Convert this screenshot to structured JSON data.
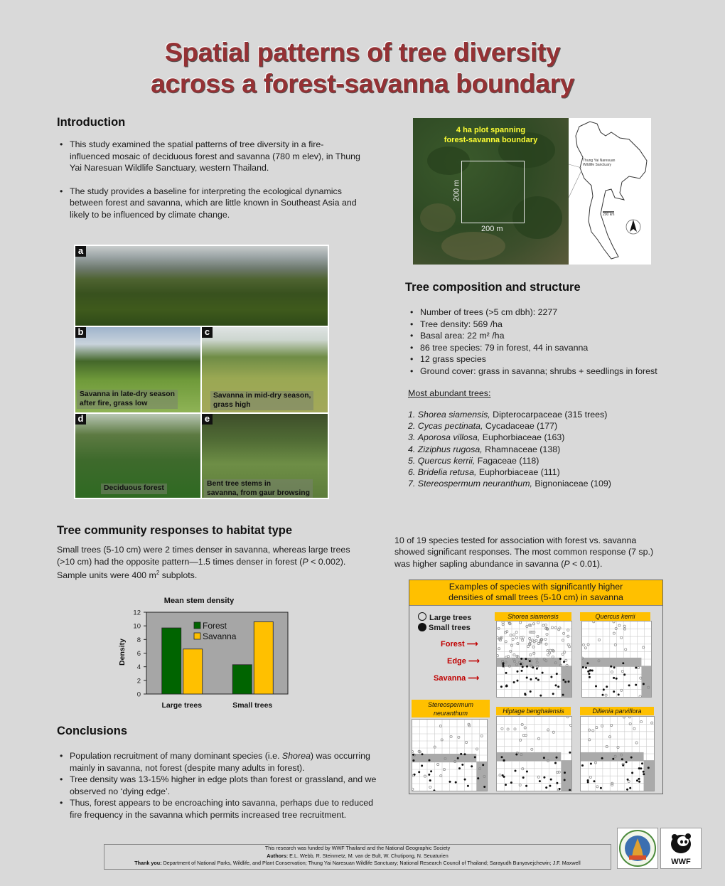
{
  "title": {
    "line1": "Spatial patterns of tree diversity",
    "line2": "across a forest-savanna boundary"
  },
  "introduction": {
    "heading": "Introduction",
    "bullets": [
      "This study examined the spatial patterns of tree diversity in a fire-influenced mosaic of deciduous forest and savanna (780 m elev), in Thung Yai Naresuan Wildlife Sanctuary, western Thailand.",
      "The study provides a baseline for interpreting the ecological dynamics between forest and savanna, which are little known in Southeast Asia and likely to be influenced by climate change."
    ]
  },
  "satellite": {
    "caption_line1": "4 ha plot spanning",
    "caption_line2": "forest-savanna boundary",
    "side_label": "200 m",
    "bottom_label": "200 m"
  },
  "map": {
    "location_label_line1": "Thung Yai Naresuan",
    "location_label_line2": "Wildlife Sanctuary",
    "scale_label": "200 km",
    "north_arrow_icon": "north-arrow-icon"
  },
  "photos": [
    {
      "letter": "a",
      "caption": ""
    },
    {
      "letter": "b",
      "caption_line1": "Savanna in late-dry season",
      "caption_line2": "after fire, grass low"
    },
    {
      "letter": "c",
      "caption_line1": "Savanna in mid-dry season,",
      "caption_line2": "grass high"
    },
    {
      "letter": "d",
      "caption_line1": "Deciduous forest",
      "caption_line2": ""
    },
    {
      "letter": "e",
      "caption_line1": "Bent tree stems in",
      "caption_line2": "savanna, from gaur browsing"
    }
  ],
  "composition": {
    "heading": "Tree composition and structure",
    "bullets": [
      "Number of trees (>5 cm dbh):  2277",
      "Tree density:  569 /ha",
      "Basal area:  22 m² /ha",
      "86 tree species:  79 in forest, 44 in savanna",
      "12 grass species",
      "Ground cover: grass in savanna; shrubs + seedlings in forest"
    ],
    "abundant_heading": "Most abundant trees:",
    "abundant": [
      {
        "n": "1.",
        "species": "Shorea siamensis,",
        "rest": " Dipterocarpaceae (315 trees)"
      },
      {
        "n": "2.",
        "species": "Cycas pectinata,",
        "rest": " Cycadaceae (177)"
      },
      {
        "n": "3.",
        "species": "Aporosa villosa,",
        "rest": " Euphorbiaceae (163)"
      },
      {
        "n": "4.",
        "species": "Ziziphus rugosa,",
        "rest": " Rhamnaceae (138)"
      },
      {
        "n": "5.",
        "species": "Quercus kerrii,",
        "rest": " Fagaceae (118)"
      },
      {
        "n": "6.",
        "species": "Bridelia retusa,",
        "rest": " Euphorbiaceae (111)"
      },
      {
        "n": "7.",
        "species": "Stereospermum neuranthum,",
        "rest": " Bignoniaceae (109)"
      }
    ]
  },
  "responses": {
    "heading": "Tree community responses to habitat type",
    "para_a": "Small trees (5-10 cm) were 2 times denser in savanna, whereas large trees (>10 cm) had the opposite pattern—1.5 times denser in forest (",
    "para_p": "P",
    "para_b": " < 0.002). Sample units were 400 m",
    "para_sup": "2",
    "para_c": " subplots."
  },
  "chart_data": {
    "type": "bar",
    "title": "Mean stem density",
    "xlabel": "",
    "ylabel": "Density",
    "categories": [
      "Large trees",
      "Small trees"
    ],
    "series": [
      {
        "name": "Forest",
        "values": [
          9.7,
          4.3
        ],
        "color": "#006400"
      },
      {
        "name": "Savanna",
        "values": [
          6.6,
          10.6
        ],
        "color": "#ffc000"
      }
    ],
    "ylim": [
      0,
      12
    ],
    "yticks": [
      0,
      2,
      4,
      6,
      8,
      10,
      12
    ],
    "grid": false,
    "legend": "top-center",
    "plot_background": "#a6a6a6"
  },
  "association": {
    "para_a": "10 of 19 species tested for association with forest vs. savanna showed significant responses. The most common response (7 sp.) was higher sapling abundance in savanna (",
    "para_p": "P",
    "para_b": " < 0.01)."
  },
  "species_box": {
    "header_line1": "Examples of species with significantly higher",
    "header_line2": "densities of small trees (5-10 cm) in savanna",
    "legend_large": "Large trees",
    "legend_small": "Small trees",
    "zone_forest": "Forest",
    "zone_edge": "Edge",
    "zone_savanna": "Savanna",
    "zone_color": "#c00000",
    "panels": [
      {
        "name": "Shorea siamensis"
      },
      {
        "name": "Quercus kerrii"
      },
      {
        "name": "Stereospermum neuranthum"
      },
      {
        "name": "Hiptage benghalensis"
      },
      {
        "name": "Dillenia parviflora"
      }
    ]
  },
  "conclusions": {
    "heading": "Conclusions",
    "b1_a": "Population recruitment of many dominant species (i.e. ",
    "b1_i": "Shorea",
    "b1_b": ") was occurring mainly in savanna, not forest (despite many adults in forest).",
    "b2": "Tree density was 13-15% higher in edge plots than forest or grassland, and we observed no ‘dying edge’.",
    "b3": "Thus, forest appears to be encroaching into savanna, perhaps due to reduced fire frequency in the savanna which permits increased tree recruitment."
  },
  "footer": {
    "funding": "This research was funded by WWF Thailand and the National Geographic Society",
    "authors_label": "Authors:",
    "authors": " E.L. Webb, R. Steinmetz, M. van de Bult, W. Chutipong, N. Seuaturien",
    "thanks_label": "Thank you:",
    "thanks": " Department of National Parks, Wildlife, and Plant Conservation; Thung Yai Naresuan Wildlife Sanctuary; National Research Council of Thailand; Sarayudh Bunyavejchewin; J.F. Maxwell"
  },
  "logos": {
    "wwf_text": "WWF"
  }
}
